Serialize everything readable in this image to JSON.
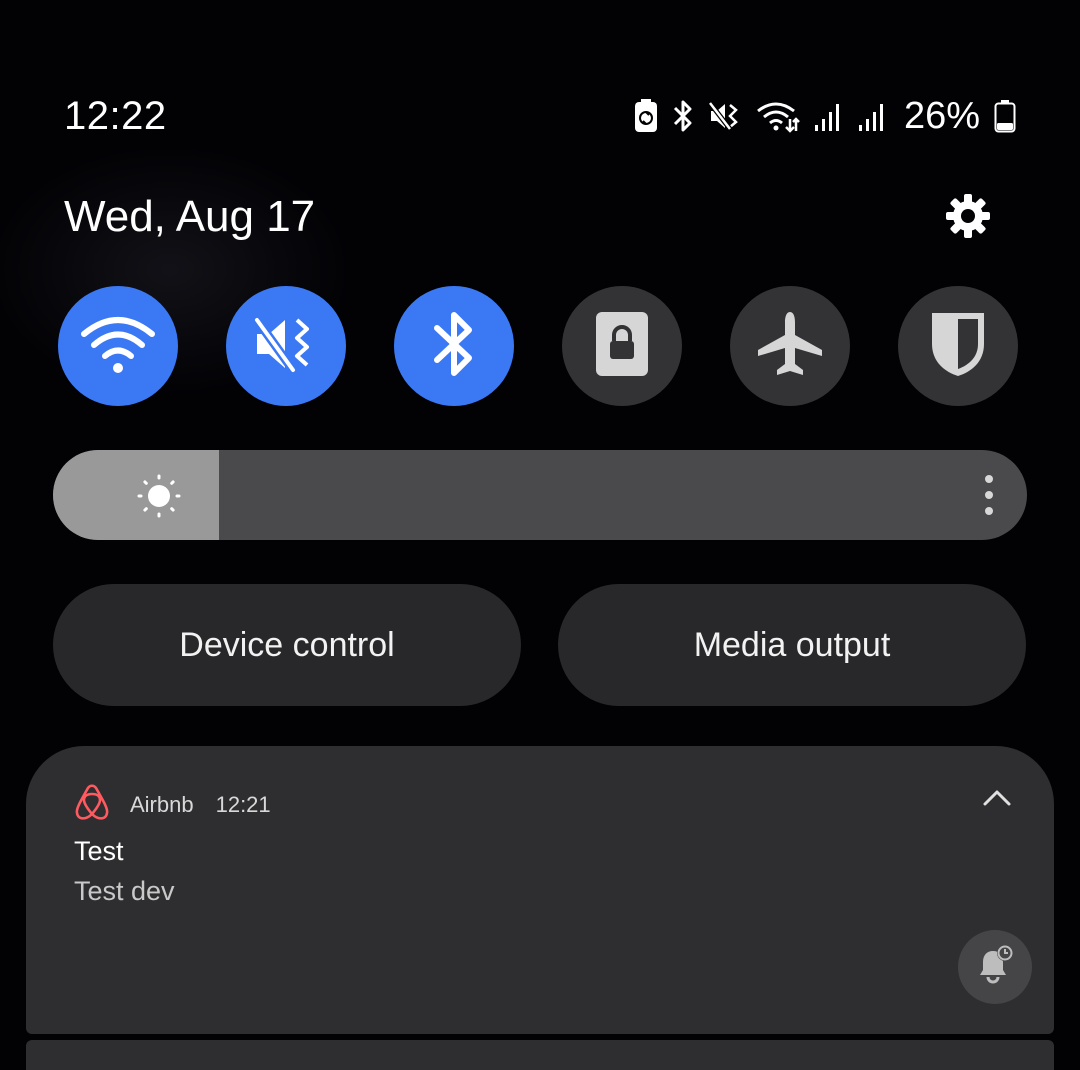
{
  "status_bar": {
    "time": "12:22",
    "battery_percent": "26%",
    "icons": [
      "battery-saver-icon",
      "bluetooth-icon",
      "mute-vibrate-icon",
      "wifi-data-icon",
      "signal-icon",
      "signal-icon",
      "battery-icon"
    ]
  },
  "header": {
    "date": "Wed, Aug 17",
    "settings_icon": "gear-icon"
  },
  "quick_tiles": [
    {
      "name": "wifi",
      "icon": "wifi-icon",
      "state": "on"
    },
    {
      "name": "sound",
      "icon": "mute-icon",
      "state": "on"
    },
    {
      "name": "bluetooth",
      "icon": "bluetooth-icon",
      "state": "on"
    },
    {
      "name": "secure-folder",
      "icon": "lock-icon",
      "state": "off"
    },
    {
      "name": "airplane",
      "icon": "airplane-icon",
      "state": "off"
    },
    {
      "name": "shield",
      "icon": "shield-icon",
      "state": "off"
    }
  ],
  "brightness": {
    "level": 0.17
  },
  "buttons": {
    "device_control": "Device control",
    "media_output": "Media output"
  },
  "notification": {
    "app": "Airbnb",
    "time": "12:21",
    "title": "Test",
    "body": "Test dev",
    "accent": "#ff5a5f"
  },
  "colors": {
    "tile_on": "#3b78f4",
    "tile_off": "#333336",
    "background": "#020205"
  }
}
